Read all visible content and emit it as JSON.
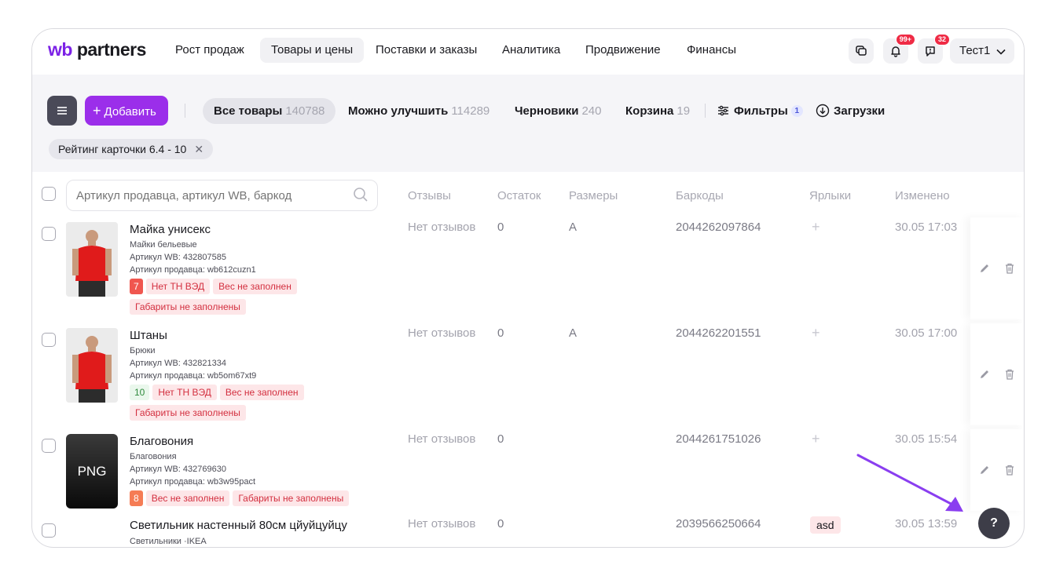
{
  "app": {
    "logo_prefix": "wb",
    "logo_suffix": "partners"
  },
  "nav": {
    "items": [
      {
        "label": "Рост продаж"
      },
      {
        "label": "Товары и цены"
      },
      {
        "label": "Поставки и заказы"
      },
      {
        "label": "Аналитика"
      },
      {
        "label": "Продвижение"
      },
      {
        "label": "Финансы"
      }
    ],
    "notifications_badge": "99+",
    "messages_badge": "32",
    "user": "Тест1"
  },
  "toolbar": {
    "add_label": "Добавить",
    "tabs": [
      {
        "label": "Все товары",
        "count": "140788"
      },
      {
        "label": "Можно улучшить",
        "count": "114289"
      },
      {
        "label": "Черновики",
        "count": "240"
      },
      {
        "label": "Корзина",
        "count": "19"
      }
    ],
    "filters_label": "Фильтры",
    "filters_count": "1",
    "downloads_label": "Загрузки",
    "active_filter_chip": "Рейтинг карточки 6.4 - 10"
  },
  "table": {
    "search_placeholder": "Артикул продавца, артикул WB, баркод",
    "columns": [
      "Отзывы",
      "Остаток",
      "Размеры",
      "Баркоды",
      "Ярлыки",
      "Изменено"
    ],
    "rows": [
      {
        "name": "Майка унисекс",
        "category": "Майки бельевые",
        "wb_article": "Артикул WB: 432807585",
        "seller_article": "Артикул продавца: wb612cuzn1",
        "score": "7",
        "tags": [
          "Нет ТН ВЭД",
          "Вес не заполнен",
          "Габариты не заполнены"
        ],
        "reviews": "Нет отзывов",
        "stock": "0",
        "size": "A",
        "barcode": "2044262097864",
        "label": "+",
        "changed": "30.05 17:03"
      },
      {
        "name": "Штаны",
        "category": "Брюки",
        "wb_article": "Артикул WB: 432821334",
        "seller_article": "Артикул продавца: wb5om67xt9",
        "score": "10",
        "tags": [
          "Нет ТН ВЭД",
          "Вес не заполнен",
          "Габариты не заполнены"
        ],
        "reviews": "Нет отзывов",
        "stock": "0",
        "size": "A",
        "barcode": "2044262201551",
        "label": "+",
        "changed": "30.05 17:00"
      },
      {
        "name": "Благовония",
        "category": "Благовония",
        "wb_article": "Артикул WB: 432769630",
        "seller_article": "Артикул продавца: wb3w95pact",
        "score": "8",
        "thumb_text": "PNG",
        "tags": [
          "Вес не заполнен",
          "Габариты не заполнены"
        ],
        "reviews": "Нет отзывов",
        "stock": "0",
        "size": "",
        "barcode": "2044261751026",
        "label": "+",
        "changed": "30.05 15:54"
      },
      {
        "name": "Светильник настенный 80см цйуйцуйцу",
        "category": "Светильники ·IKEA",
        "reviews": "Нет отзывов",
        "stock": "0",
        "barcode": "2039566250664",
        "label": "asd",
        "changed": "30.05 13:59"
      }
    ]
  },
  "help": {
    "label": "?"
  },
  "colors": {
    "accent": "#9b2eea",
    "arrow": "#8a3ef0",
    "badge": "#ef2b45"
  }
}
